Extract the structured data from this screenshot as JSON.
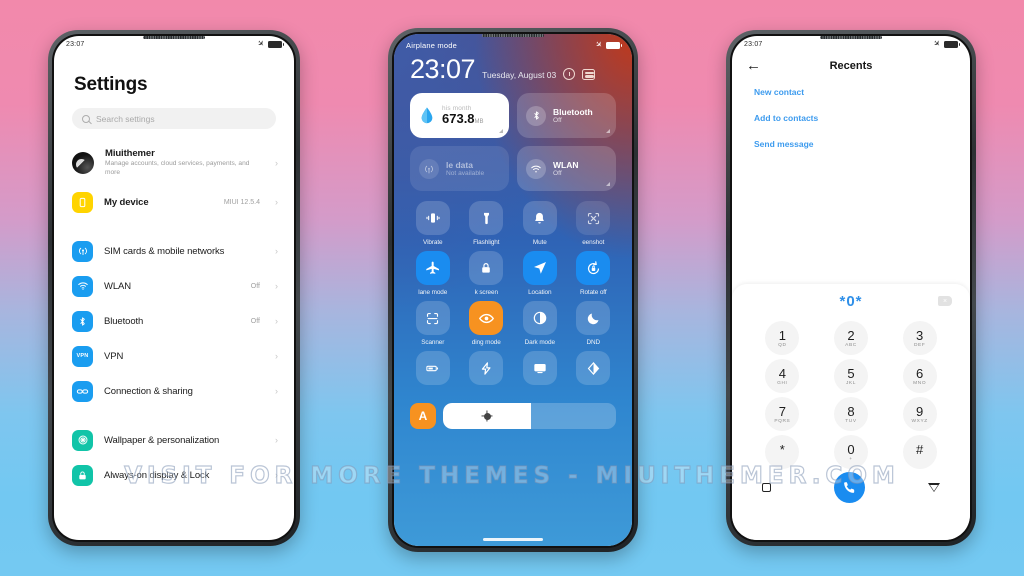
{
  "watermark": "VISIT FOR MORE THEMES - MIUITHEMER.COM",
  "colors": {
    "accent_blue": "#1a8cf0",
    "orange": "#f79220",
    "link_blue": "#3d9bee",
    "yellow": "#ffd400",
    "teal": "#11c4a8"
  },
  "phone1": {
    "statusbar": {
      "time": "23:07"
    },
    "title": "Settings",
    "search": {
      "placeholder": "Search settings"
    },
    "items": [
      {
        "label": "Miuithemer",
        "sub": "Manage accounts, cloud services, payments, and more",
        "value": "",
        "icon": "account-avatar"
      },
      {
        "label": "My device",
        "sub": "",
        "value": "MIUI 12.5.4",
        "icon": "phone-icon"
      },
      {
        "label": "SIM cards & mobile networks",
        "sub": "",
        "value": "",
        "icon": "sim-signal-icon"
      },
      {
        "label": "WLAN",
        "sub": "",
        "value": "Off",
        "icon": "wifi-icon"
      },
      {
        "label": "Bluetooth",
        "sub": "",
        "value": "Off",
        "icon": "bluetooth-icon"
      },
      {
        "label": "VPN",
        "sub": "",
        "value": "",
        "icon": "vpn-icon"
      },
      {
        "label": "Connection & sharing",
        "sub": "",
        "value": "",
        "icon": "link-icon"
      },
      {
        "label": "Wallpaper & personalization",
        "sub": "",
        "value": "",
        "icon": "wallpaper-icon"
      },
      {
        "label": "Always-on display & Lock",
        "sub": "",
        "value": "",
        "icon": "lock-icon"
      }
    ]
  },
  "phone2": {
    "statusbar": {
      "label": "Airplane mode"
    },
    "clock": "23:07",
    "date": "Tuesday, August 03",
    "data_card": {
      "label": "his month",
      "value": "673.8",
      "unit": "MB",
      "icon": "data-drop-icon"
    },
    "big_tiles": [
      {
        "name": "Bluetooth",
        "state": "Off",
        "icon": "bluetooth-icon",
        "active": false
      },
      {
        "name": "le data",
        "state": "Not available",
        "icon": "mobile-data-icon",
        "active": false
      },
      {
        "name": "WLAN",
        "state": "Off",
        "icon": "wifi-icon",
        "active": false
      }
    ],
    "toggles": [
      {
        "label": "Vibrate",
        "icon": "vibrate-icon",
        "state": "glass"
      },
      {
        "label": "Flashlight",
        "icon": "flashlight-icon",
        "state": "glass"
      },
      {
        "label": "Mute",
        "icon": "bell-icon",
        "state": "glass"
      },
      {
        "label": "eenshot",
        "icon": "screenshot-icon",
        "state": "faint"
      },
      {
        "label": "lane mode",
        "icon": "airplane-icon",
        "state": "on"
      },
      {
        "label": "k screen",
        "icon": "lock-icon",
        "state": "glass"
      },
      {
        "label": "Location",
        "icon": "location-icon",
        "state": "on"
      },
      {
        "label": "Rotate off",
        "icon": "rotate-lock-icon",
        "state": "on"
      },
      {
        "label": "Scanner",
        "icon": "scanner-icon",
        "state": "glass"
      },
      {
        "label": "ding mode",
        "icon": "eye-icon",
        "state": "orange"
      },
      {
        "label": "Dark mode",
        "icon": "contrast-icon",
        "state": "glass"
      },
      {
        "label": "DND",
        "icon": "moon-icon",
        "state": "glass"
      },
      {
        "label": "",
        "icon": "battery-saver-icon",
        "state": "glass"
      },
      {
        "label": "",
        "icon": "lightning-icon",
        "state": "glass"
      },
      {
        "label": "",
        "icon": "cast-screen-icon",
        "state": "glass"
      },
      {
        "label": "",
        "icon": "reading-mode-icon",
        "state": "glass"
      }
    ],
    "brightness": {
      "auto_label": "A",
      "icon": "sun-icon",
      "percent": 51
    }
  },
  "phone3": {
    "statusbar": {
      "time": "23:07"
    },
    "title": "Recents",
    "back_icon": "back-arrow-icon",
    "links": [
      "New contact",
      "Add to contacts",
      "Send message"
    ],
    "dialed_number": "*0*",
    "backspace_icon": "backspace-icon",
    "keys": [
      {
        "digit": "1",
        "letters": "QD"
      },
      {
        "digit": "2",
        "letters": "ABC"
      },
      {
        "digit": "3",
        "letters": "DEF"
      },
      {
        "digit": "4",
        "letters": "GHI"
      },
      {
        "digit": "5",
        "letters": "JKL"
      },
      {
        "digit": "6",
        "letters": "MNO"
      },
      {
        "digit": "7",
        "letters": "PQRS"
      },
      {
        "digit": "8",
        "letters": "TUV"
      },
      {
        "digit": "9",
        "letters": "WXYZ"
      },
      {
        "digit": "*",
        "letters": ""
      },
      {
        "digit": "0",
        "letters": "+"
      },
      {
        "digit": "#",
        "letters": ""
      }
    ],
    "nav": {
      "recents_icon": "square-icon",
      "call_icon": "call-icon",
      "back_icon": "triangle-back-icon"
    }
  }
}
